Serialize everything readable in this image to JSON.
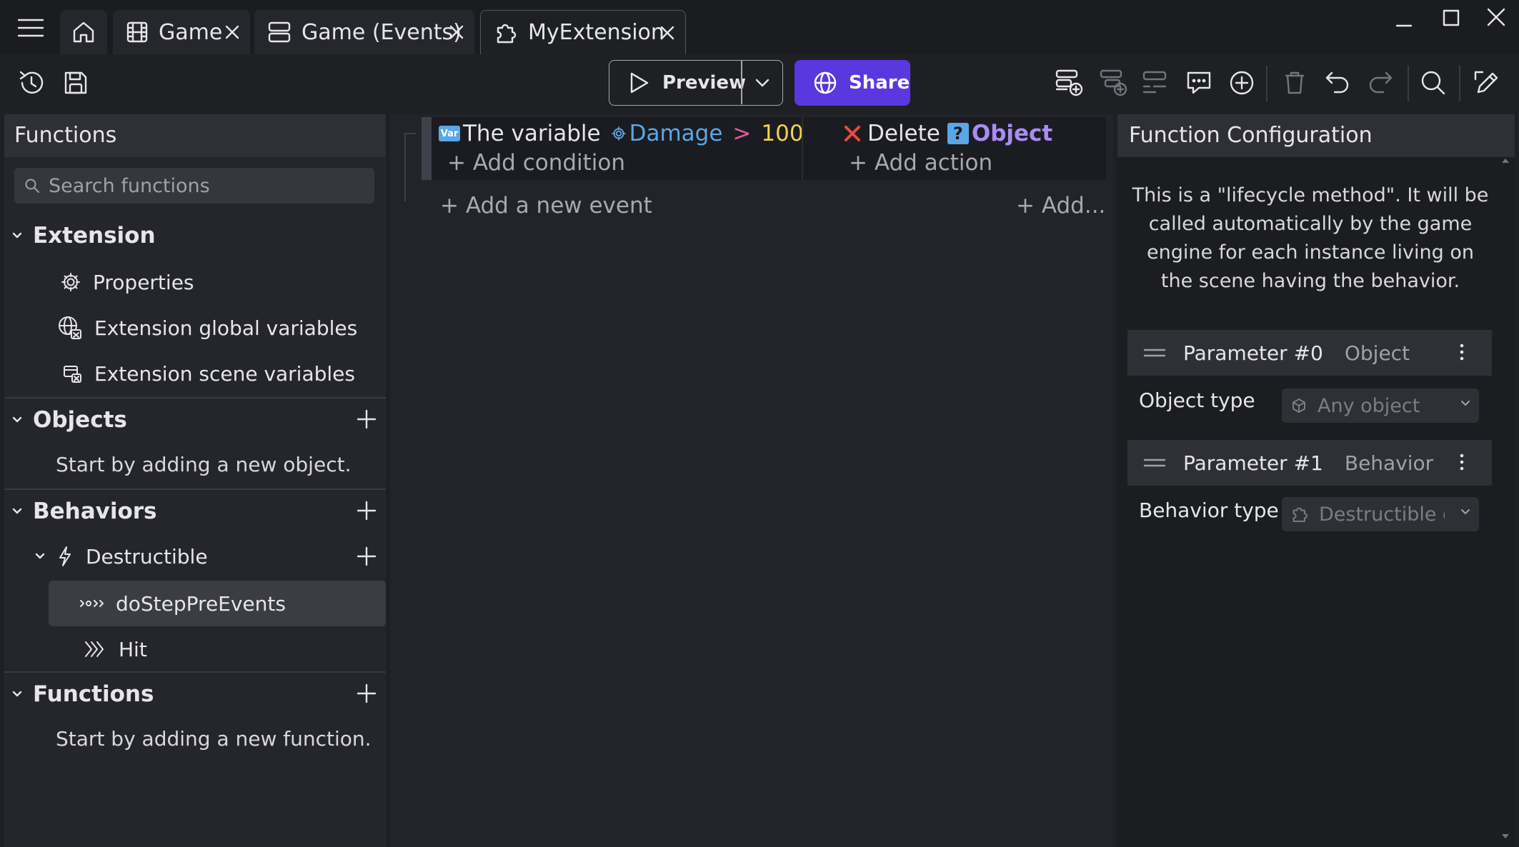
{
  "tabs": [
    {
      "label": "Game",
      "icon": "film-icon"
    },
    {
      "label": "Game (Events)",
      "icon": "events-icon"
    },
    {
      "label": "MyExtension",
      "icon": "puzzle-icon"
    }
  ],
  "toolbar": {
    "preview_label": "Preview",
    "share_label": "Share"
  },
  "left_panel": {
    "title": "Functions",
    "search_placeholder": "Search functions",
    "sections": {
      "extension": {
        "title": "Extension",
        "items": [
          {
            "label": "Properties",
            "icon": "gear-icon"
          },
          {
            "label": "Extension global variables",
            "icon": "globe-variables-icon"
          },
          {
            "label": "Extension scene variables",
            "icon": "scene-variables-icon"
          }
        ]
      },
      "objects": {
        "title": "Objects",
        "hint": "Start by adding a new object."
      },
      "behaviors": {
        "title": "Behaviors",
        "behavior_name": "Destructible",
        "functions": [
          {
            "label": "doStepPreEvents",
            "icon": "lifecycle-icon"
          },
          {
            "label": "Hit",
            "icon": "chevrons-icon"
          }
        ]
      },
      "functions": {
        "title": "Functions",
        "hint": "Start by adding a new function."
      }
    }
  },
  "events": {
    "condition": {
      "badge": "Var",
      "prefix": "The variable",
      "variable": "Damage",
      "operator": ">",
      "value": "100"
    },
    "action": {
      "verb": "Delete",
      "object": "Object"
    },
    "add_condition": "+ Add condition",
    "add_action": "+ Add action",
    "add_event": "+ Add a new event",
    "add_other": "+ Add..."
  },
  "right_panel": {
    "title": "Function Configuration",
    "lifecycle_text": "This is a \"lifecycle method\". It will be called automatically by the game engine for each instance living on the scene having the behavior.",
    "parameters": [
      {
        "name": "Parameter #0",
        "type": "Object",
        "field_label": "Object type",
        "field_value": "Any object"
      },
      {
        "name": "Parameter #1",
        "type": "Behavior",
        "field_label": "Behavior type",
        "field_value": "Destructible capability"
      }
    ]
  },
  "colors": {
    "accent": "#5b37e0",
    "variable_blue": "#5aa7e6",
    "operator_pink": "#e25c9e",
    "value_yellow": "#f2d24a",
    "object_purple": "#a98cf5",
    "delete_red": "#e74c3c"
  }
}
